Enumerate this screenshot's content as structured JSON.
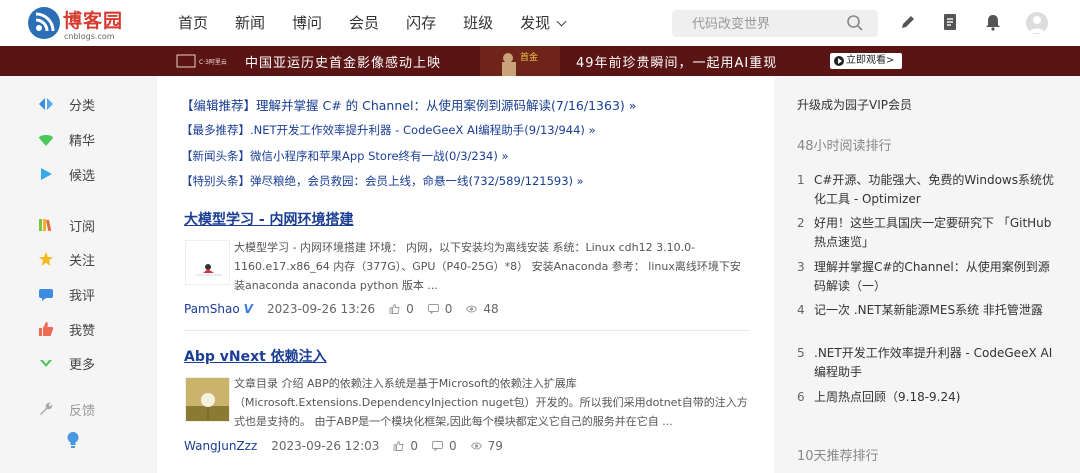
{
  "header": {
    "logo_title": "博客园",
    "logo_sub": "cnblogs.com",
    "nav": [
      "首页",
      "新闻",
      "博问",
      "会员",
      "闪存",
      "班级",
      "发现"
    ],
    "search_placeholder": "代码改变世界",
    "icons": [
      "edit-icon",
      "document-icon",
      "bell-icon",
      "avatar"
    ]
  },
  "banner": {
    "logo_text": "C·3阿里云",
    "text1": "中国亚运历史首金影像感动上映",
    "text2": "49年前珍贵瞬间，一起用AI重现",
    "button": "立即观看>",
    "colors": {
      "background": "#5b1414"
    }
  },
  "sidebar": {
    "items": [
      {
        "label": "分类",
        "icon": "category-icon"
      },
      {
        "label": "精华",
        "icon": "gem-icon"
      },
      {
        "label": "候选",
        "icon": "play-icon"
      },
      {
        "label": "订阅",
        "icon": "books-icon"
      },
      {
        "label": "关注",
        "icon": "star-icon"
      },
      {
        "label": "我评",
        "icon": "comment-icon"
      },
      {
        "label": "我赞",
        "icon": "thumbs-up-icon"
      },
      {
        "label": "更多",
        "icon": "chevron-down-icon"
      },
      {
        "label": "反馈",
        "icon": "wrench-icon"
      }
    ]
  },
  "recommend": [
    "【编辑推荐】理解并掌握 C# 的 Channel：从使用案例到源码解读(7/16/1363) »",
    "【最多推荐】.NET开发工作效率提升利器 - CodeGeeX AI编程助手(9/13/944) »",
    "【新闻头条】微信小程序和苹果App Store终有一战(0/3/234) »",
    "【特别头条】弹尽粮绝，会员救园：会员上线，命悬一线(732/589/121593) »"
  ],
  "posts": [
    {
      "title": "大模型学习 - 内网环境搭建",
      "summary": "大模型学习 - 内网环境搭建 环境： 内网，以下安装均为离线安装 系统：Linux cdh12 3.10.0-1160.e17.x86_64 内存（377G）、GPU（P40-25G）*8） 安装Anaconda 参考： linux离线环境下安装anaconda anaconda python 版本 ...",
      "author": "PamShao",
      "badge": "V",
      "date": "2023-09-26 13:26",
      "likes": "0",
      "comments": "0",
      "views": "48"
    },
    {
      "title": "Abp vNext 依赖注入",
      "summary": "文章目录 介绍 ABP的依赖注入系统是基于Microsoft的依赖注入扩展库（Microsoft.Extensions.DependencyInjection nuget包）开发的。所以我们采用dotnet自带的注入方式也是支持的。 由于ABP是一个模块化框架,因此每个模块都定义它自己的服务并在它自 ...",
      "author": "WangJunZzz",
      "date": "2023-09-26 12:03",
      "likes": "0",
      "comments": "0",
      "views": "79"
    }
  ],
  "right": {
    "vip_link": "升级成为园子VIP会员",
    "head_48h": "48小时阅读排行",
    "ranking": [
      {
        "num": "1",
        "text": "C#开源、功能强大、免费的Windows系统优化工具 - Optimizer"
      },
      {
        "num": "2",
        "text": "好用！这些工具国庆一定要研究下 「GitHub 热点速览」"
      },
      {
        "num": "3",
        "text": "理解并掌握C#的Channel：从使用案例到源码解读（一）"
      },
      {
        "num": "4",
        "text": "记一次 .NET某新能源MES系统 非托管泄露"
      },
      {
        "num": "5",
        "text": ".NET开发工作效率提升利器 - CodeGeeX AI编程助手"
      },
      {
        "num": "6",
        "text": "上周热点回顾（9.18-9.24)"
      }
    ],
    "head_10d": "10天推荐排行"
  }
}
